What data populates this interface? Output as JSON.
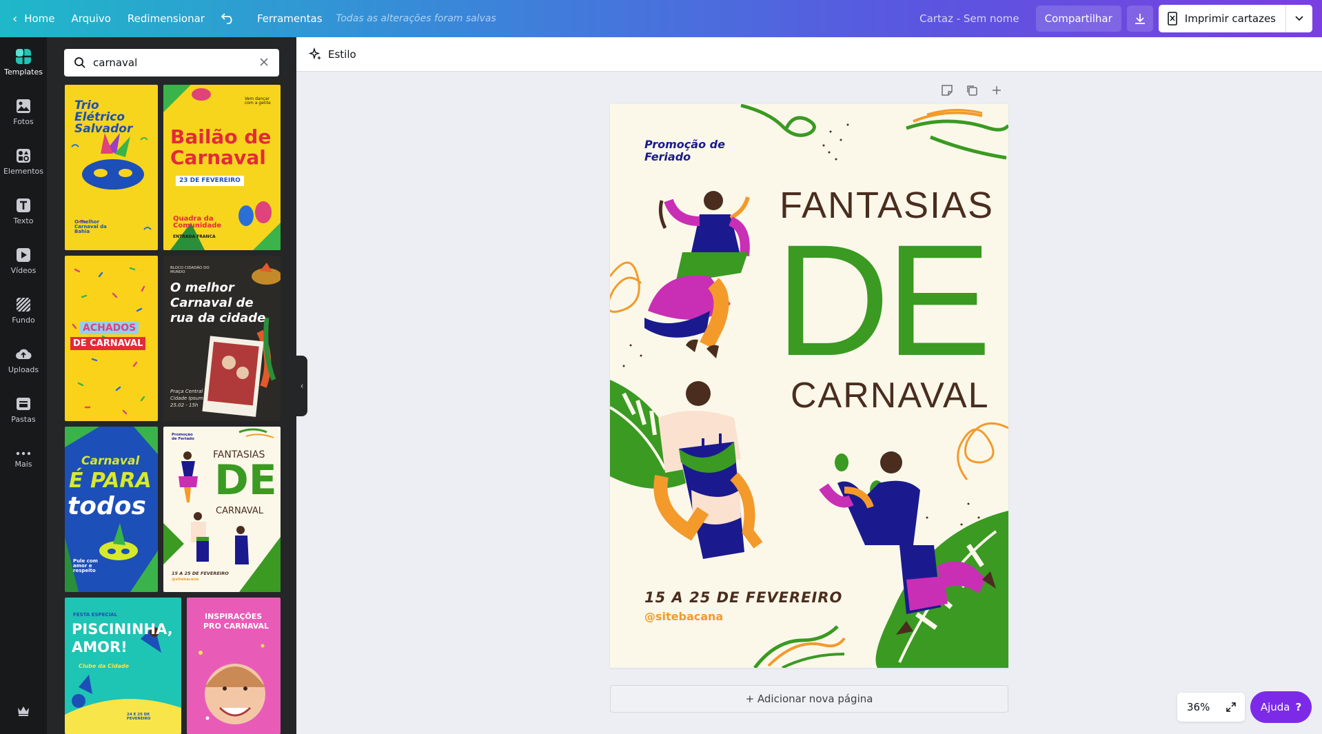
{
  "topbar": {
    "home": "Home",
    "file": "Arquivo",
    "resize": "Redimensionar",
    "tools": "Ferramentas",
    "saved_status": "Todas as alterações foram salvas",
    "doc_name": "Cartaz - Sem nome",
    "share": "Compartilhar",
    "print": "Imprimir cartazes"
  },
  "rail": {
    "items": [
      {
        "label": "Templates",
        "icon": "templates-icon"
      },
      {
        "label": "Fotos",
        "icon": "photos-icon"
      },
      {
        "label": "Elementos",
        "icon": "elements-icon"
      },
      {
        "label": "Texto",
        "icon": "text-icon"
      },
      {
        "label": "Vídeos",
        "icon": "videos-icon"
      },
      {
        "label": "Fundo",
        "icon": "background-icon"
      },
      {
        "label": "Uploads",
        "icon": "uploads-icon"
      },
      {
        "label": "Pastas",
        "icon": "folders-icon"
      },
      {
        "label": "Mais",
        "icon": "more-icon"
      }
    ]
  },
  "search": {
    "value": "carnaval"
  },
  "thumbs": {
    "t1": [
      "Trio",
      "Elétrico",
      "Salvador",
      "O melhor Carnaval da Bahia"
    ],
    "t2": [
      "Bailão de",
      "Carnaval",
      "23 DE FEVEREIRO",
      "Quadra da Comunidade",
      "ENTRADA FRANCA",
      "Vem dançar com a gente"
    ],
    "t3": [
      "ACHADOS",
      "DE CARNAVAL"
    ],
    "t4": [
      "BLOCO CIDADÃO DO MUNDO",
      "O melhor",
      "Carnaval de",
      "rua da cidade",
      "Praça Central",
      "Cidade Ipsum",
      "25.02 - 15h"
    ],
    "t5": [
      "Carnaval",
      "É PARA",
      "todos",
      "Pule com amor e respeito"
    ],
    "t6": [
      "Promoção de Feriado",
      "FANTASIAS",
      "DE",
      "CARNAVAL",
      "15 A 25 DE FEVEREIRO",
      "@sitebacana"
    ],
    "t7": [
      "FESTA ESPECIAL",
      "PISCININHA,",
      "AMOR!",
      "Clube da Cidade",
      "24 E 25 DE FEVEREIRO"
    ],
    "t8": [
      "INSPIRAÇÕES",
      "PRO CARNAVAL"
    ]
  },
  "toolbar": {
    "style": "Estilo"
  },
  "poster": {
    "promo": [
      "Promoção de",
      "Feriado"
    ],
    "title1": "FANTASIAS",
    "title2": "DE",
    "title3": "CARNAVAL",
    "dates": "15 A 25 DE FEVEREIRO",
    "handle": "@sitebacana"
  },
  "add_page": "+ Adicionar nova página",
  "zoom": "36%",
  "help": "Ajuda",
  "help_symbol": "?",
  "colors": {
    "green": "#3a9a22",
    "brown": "#4a2d1f",
    "navy": "#1a1a8e",
    "orange": "#f39a2b",
    "purple": "#7d2ae8"
  }
}
